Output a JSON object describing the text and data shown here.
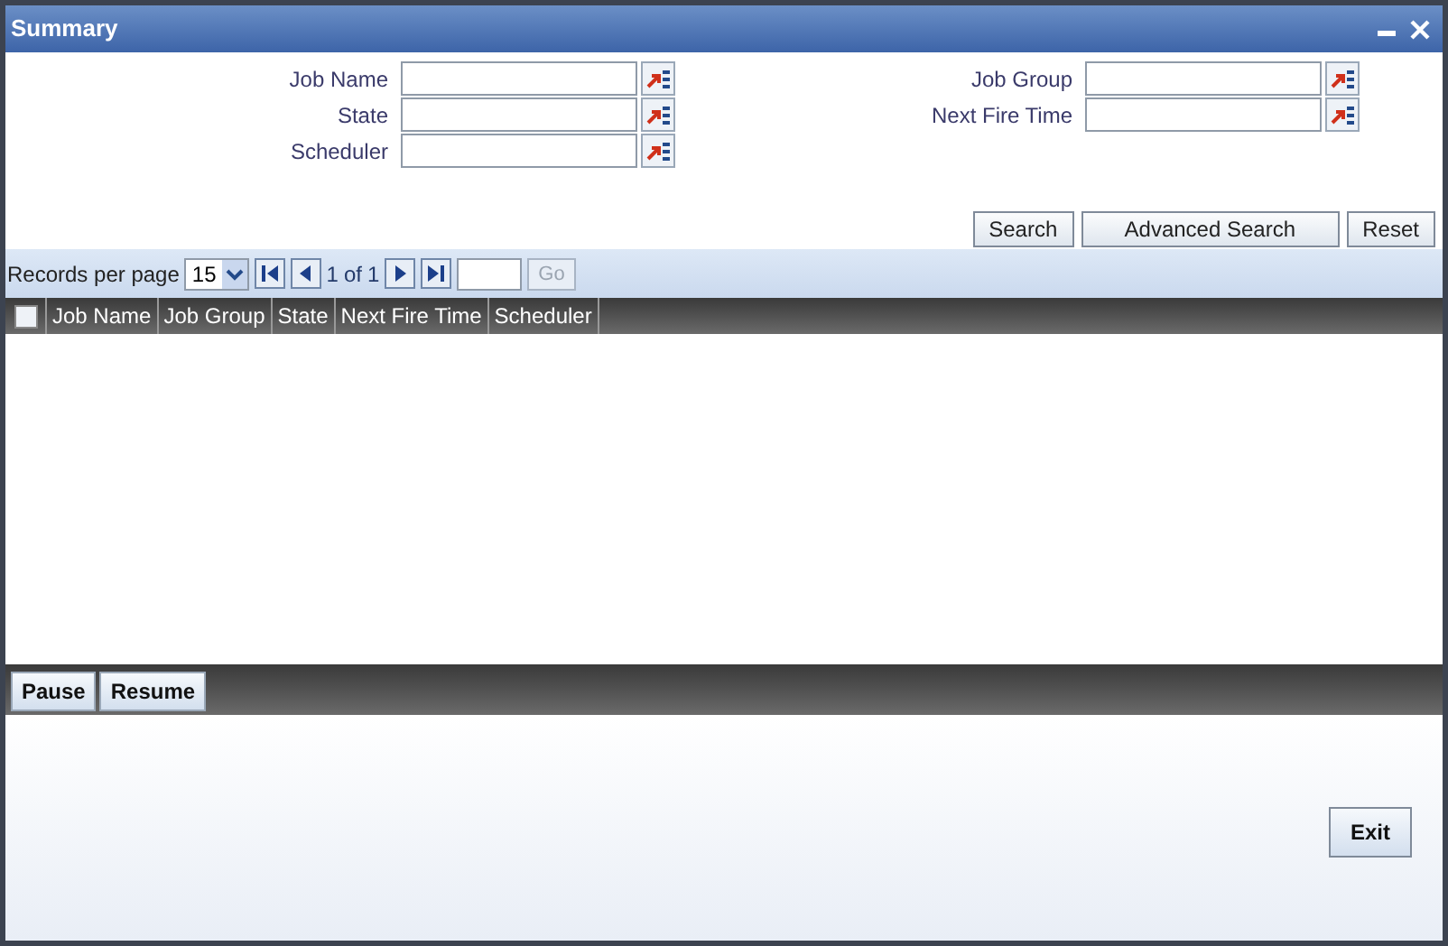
{
  "window": {
    "title": "Summary"
  },
  "search_fields": {
    "left": [
      {
        "label": "Job Name"
      },
      {
        "label": "State"
      },
      {
        "label": "Scheduler"
      }
    ],
    "right": [
      {
        "label": "Job Group"
      },
      {
        "label": "Next Fire Time"
      }
    ]
  },
  "search_buttons": [
    "Search",
    "Advanced Search",
    "Reset"
  ],
  "pager": {
    "records_label": "Records per page",
    "per_page": "15",
    "current": "1",
    "of": "of",
    "total": "1",
    "go": "Go",
    "go_disabled": true
  },
  "table": {
    "select_all": {
      "checked": false
    },
    "columns": [
      "Job Name",
      "Job Group",
      "State",
      "Next Fire Time",
      "Scheduler"
    ]
  },
  "actions": [
    "Pause",
    "Resume"
  ],
  "footer_buttons": [
    "Exit"
  ]
}
